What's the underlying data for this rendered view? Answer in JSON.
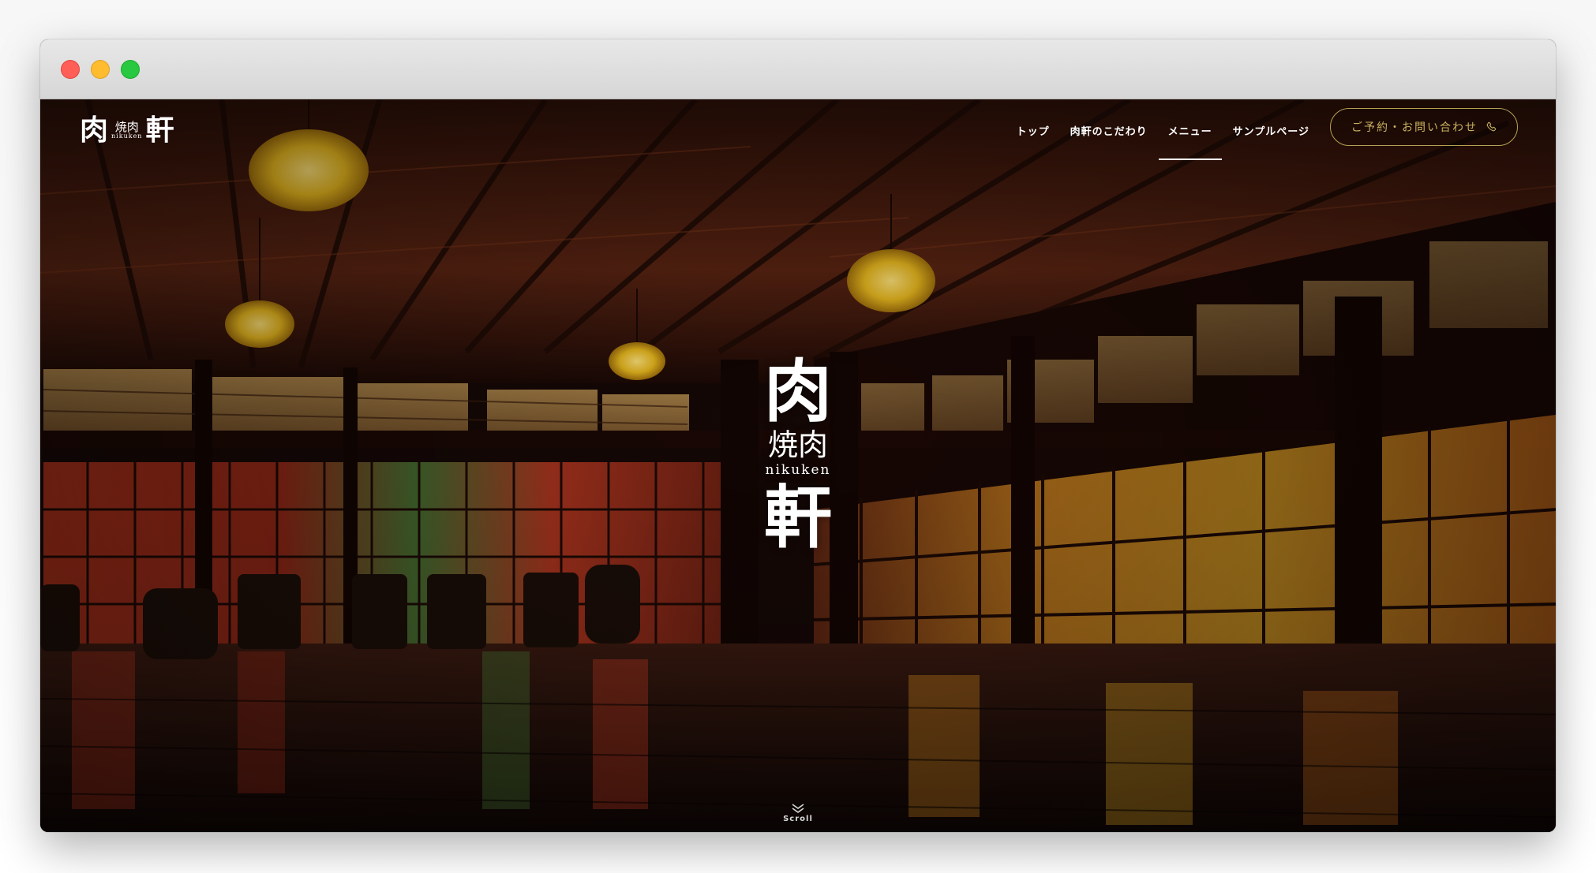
{
  "brand": {
    "logo_niku": "肉",
    "logo_yakiniku": "焼肉",
    "logo_roman": "nikuken",
    "logo_ken": "軒"
  },
  "nav": {
    "items": [
      {
        "label": "トップ",
        "active": false
      },
      {
        "label": "肉軒のこだわり",
        "active": false
      },
      {
        "label": "メニュー",
        "active": true
      },
      {
        "label": "サンプルページ",
        "active": false
      }
    ],
    "reserve_label": "ご予約・お問い合わせ",
    "reserve_icon": "phone-icon"
  },
  "hero": {
    "center_logo": {
      "niku": "肉",
      "yakiniku": "焼肉",
      "roman": "nikuken",
      "ken": "軒"
    },
    "scroll_label": "Scroll",
    "scroll_icon": "double-chevron-down-icon"
  },
  "colors": {
    "accent_gold": "#c9b261",
    "nav_text": "#ffffff",
    "traffic_red": "#ff5f57",
    "traffic_yellow": "#febc2e",
    "traffic_green": "#28c840"
  }
}
